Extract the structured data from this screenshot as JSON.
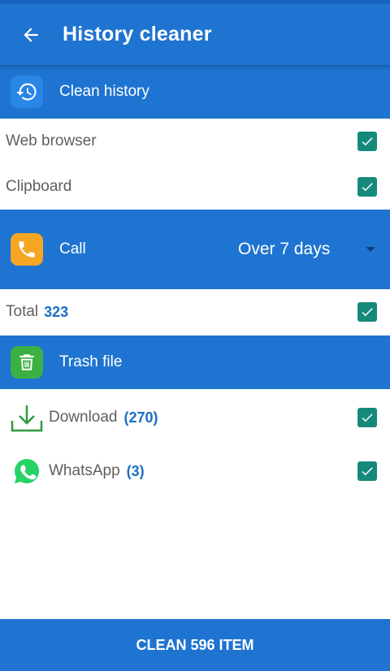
{
  "app": {
    "title": "History cleaner"
  },
  "colors": {
    "primary": "#1e74d0",
    "checkbox": "#158a7a",
    "call_icon_bg": "#f5a623",
    "trash_icon_bg": "#3cb043",
    "download_icon": "#2e9b3e",
    "whatsapp": "#25d366"
  },
  "sections": {
    "history": {
      "label": "Clean history",
      "icon": "history-icon"
    },
    "call": {
      "label": "Call",
      "icon": "phone-icon",
      "period": "Over 7 days"
    },
    "trash": {
      "label": "Trash file",
      "icon": "trash-icon"
    }
  },
  "history_items": [
    {
      "label": "Web browser",
      "checked": true
    },
    {
      "label": "Clipboard",
      "checked": true
    }
  ],
  "call_total": {
    "label": "Total",
    "count": "323",
    "checked": true
  },
  "trash_items": [
    {
      "label": "Download",
      "count": "(270)",
      "icon": "download-icon",
      "checked": true
    },
    {
      "label": "WhatsApp",
      "count": "(3)",
      "icon": "whatsapp-icon",
      "checked": true
    }
  ],
  "action": {
    "label": "CLEAN 596 ITEM"
  }
}
